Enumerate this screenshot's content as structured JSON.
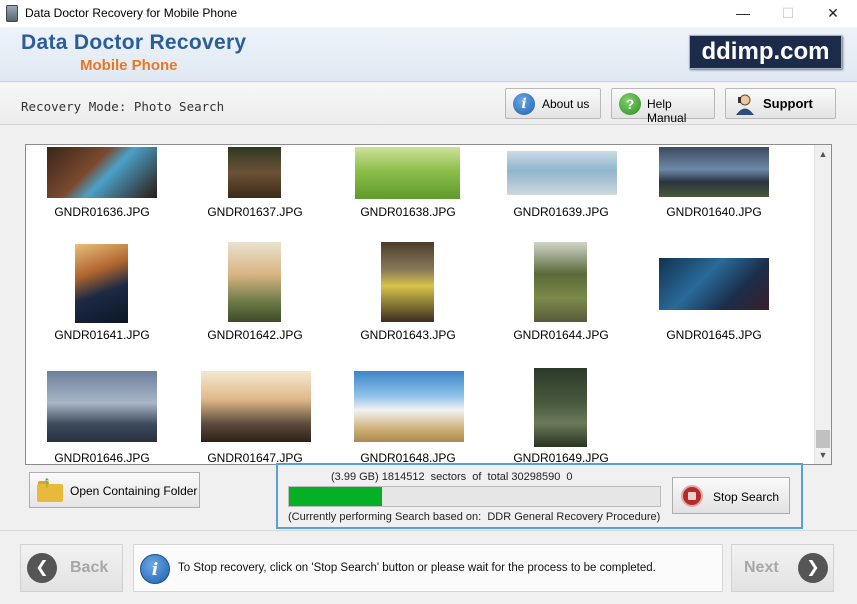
{
  "window": {
    "title": "Data Doctor Recovery for Mobile Phone",
    "minimize": "—",
    "maximize": "☐",
    "close": "✕"
  },
  "header": {
    "brand_main": "Data Doctor Recovery",
    "brand_sub": "Mobile Phone",
    "site_logo": "ddimp.com"
  },
  "toolbar": {
    "mode_label": "Recovery Mode: Photo Search",
    "about_label": "About us",
    "help_label": "Help Manual",
    "support_label": "Support"
  },
  "gallery": {
    "files": [
      "GNDR01636.JPG",
      "GNDR01637.JPG",
      "GNDR01638.JPG",
      "GNDR01639.JPG",
      "GNDR01640.JPG",
      "GNDR01641.JPG",
      "GNDR01642.JPG",
      "GNDR01643.JPG",
      "GNDR01644.JPG",
      "GNDR01645.JPG",
      "GNDR01646.JPG",
      "GNDR01647.JPG",
      "GNDR01648.JPG",
      "GNDR01649.JPG"
    ],
    "scroll_up": "▲",
    "scroll_down": "▼"
  },
  "actions": {
    "open_folder_label": "Open Containing Folder"
  },
  "progress": {
    "sectors_text": "(3.99 GB) 1814512  sectors  of  total 30298590  0",
    "fraction": 0.25,
    "method_text": "(Currently performing Search based on:  DDR General Recovery Procedure)",
    "stop_label": "Stop Search"
  },
  "footer": {
    "back_label": "Back",
    "next_label": "Next",
    "back_icon": "❮",
    "next_icon": "❯",
    "info_icon_glyph": "i",
    "info_text": "To Stop recovery, click on 'Stop Search' button or please wait for the process to be completed."
  },
  "colors": {
    "progress_fill": "#06b025",
    "brand_blue": "#2a5d9a",
    "brand_orange": "#e87822",
    "highlight_border": "#5aa0d8"
  }
}
